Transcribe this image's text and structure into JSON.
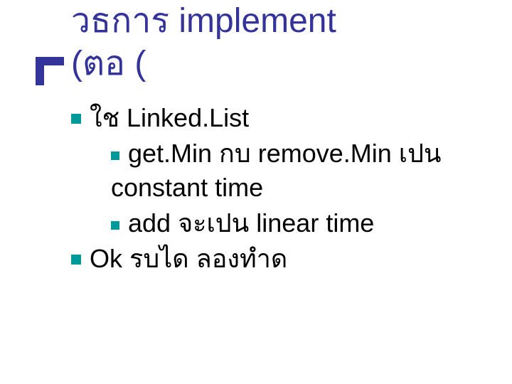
{
  "title": {
    "line1": "วธการ    implement",
    "line2": "(ตอ  ("
  },
  "body": {
    "item1": "ใช   Linked.List",
    "item1_sub1": "get.Min กบ   remove.Min เปน constant time",
    "item1_sub2": "add จะเปน   linear time",
    "item2": "Ok  รบได     ลองทำด"
  },
  "colors": {
    "title": "#333399",
    "bullet": "#009999",
    "text": "#000000"
  }
}
